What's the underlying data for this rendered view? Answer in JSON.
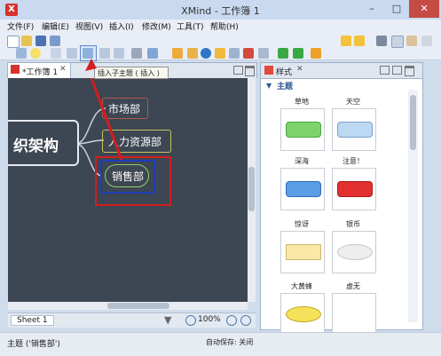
{
  "window": {
    "title": "XMind - 工作簿 1",
    "app_icon": "X"
  },
  "window_controls": {
    "minimize": "–",
    "maximize": "□",
    "close": "✕"
  },
  "menu": [
    "文件(F)",
    "编辑(E)",
    "视图(V)",
    "插入(I)",
    "修改(M)",
    "工具(T)",
    "帮助(H)"
  ],
  "tooltip": "插入子主题 ( 插入 )",
  "editor": {
    "tab_label": "*工作簿 1",
    "central_topic": "织架构",
    "subtopics": [
      "市场部",
      "人力资源部",
      "销售部"
    ]
  },
  "sheetbar": {
    "sheet_tab": "Sheet 1",
    "zoom": "100%"
  },
  "style_panel": {
    "tab_label": "样式",
    "section_title": "主题",
    "swatches": [
      {
        "label": "草地",
        "color": "#7ed36d",
        "border": "#4ea43b",
        "shape": "round-rect"
      },
      {
        "label": "天空",
        "color": "#bcd8f2",
        "border": "#7aa3c9",
        "shape": "round-rect"
      },
      {
        "label": "深海",
        "color": "#5a9ee6",
        "border": "#2c6db8",
        "shape": "round-rect"
      },
      {
        "label": "注意！",
        "color": "#e23030",
        "border": "#a81a1a",
        "shape": "round-rect"
      },
      {
        "label": "惊讶",
        "color": "#fbe8a6",
        "border": "#c9b56a",
        "shape": "rect"
      },
      {
        "label": "银币",
        "color": "#eeeeee",
        "border": "#c7c7c7",
        "shape": "ellipse"
      },
      {
        "label": "大黄蜂",
        "color": "#f5e15a",
        "border": "#c1a82a",
        "shape": "ellipse"
      },
      {
        "label": "虚无",
        "color": "#ffffff",
        "border": "#ffffff",
        "shape": "none"
      }
    ]
  },
  "status": {
    "left": "主题 ('销售部')",
    "autosave": "自动保存: 关闭"
  },
  "colors": {
    "canvas": "#3d4653",
    "highlight": "#d41d1d",
    "selection": "#1f3cb7"
  }
}
